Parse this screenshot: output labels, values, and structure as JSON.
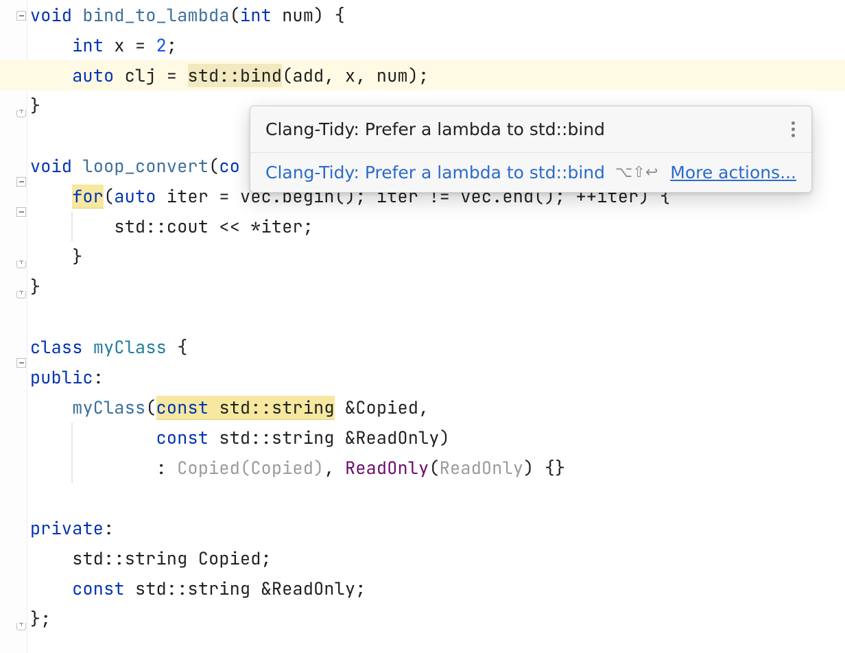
{
  "code": {
    "l1_void": "void",
    "l1_fn": "bind_to_lambda",
    "l1_int": "int",
    "l1_after": " num) {",
    "l2_int": "int",
    "l2_rest": " x = ",
    "l2_num": "2",
    "l2_semi": ";",
    "l3_auto": "auto",
    "l3_mid": " clj = ",
    "l3_std": "std",
    "l3_bind": "::bind",
    "l3_after": "(add, x, num);",
    "l4": "}",
    "l5_void": "void",
    "l5_fn": "loop_convert",
    "l5_open": "(",
    "l5_co": "co",
    "l6_for": "for",
    "l6_open": "(",
    "l6_auto": "auto",
    "l6_rest": " iter = vec.begin(); iter != vec.end(); ++iter) {",
    "l7_std": "std::cout",
    "l7_rest": " << *iter;",
    "l8": "}",
    "l9": "}",
    "l10_class": "class",
    "l10_name": " myClass ",
    "l10_brace": "{",
    "l11_public": "public",
    "l11_colon": ":",
    "l12_ctor": "myClass",
    "l12_open": "(",
    "l12_const": "const",
    "l12_sp": " ",
    "l12_ty": "std::string",
    "l12_after": " &Copied,",
    "l13_const": "const",
    "l13_ty": " std::string",
    "l13_after": " &ReadOnly)",
    "l14_colon": ": ",
    "l14_copied": "Copied",
    "l14_arg1a": "(",
    "l14_arg1p": "Copied",
    "l14_arg1b": ")",
    "l14_comma": ", ",
    "l14_readonly": "ReadOnly",
    "l14_arg2a": "(",
    "l14_arg2p": "ReadOnly",
    "l14_arg2b": ")",
    "l14_end": " {}",
    "l15_private": "private",
    "l15_colon": ":",
    "l16_ty": "std::string",
    "l16_name": " Copied;",
    "l17_const": "const",
    "l17_ty": " std::string",
    "l17_name": " &ReadOnly;",
    "l18": "};"
  },
  "popup": {
    "title": "Clang-Tidy: Prefer a lambda to std::bind",
    "action": "Clang-Tidy: Prefer a lambda to std::bind",
    "shortcut": "⌥⇧↩",
    "more": "More actions..."
  }
}
